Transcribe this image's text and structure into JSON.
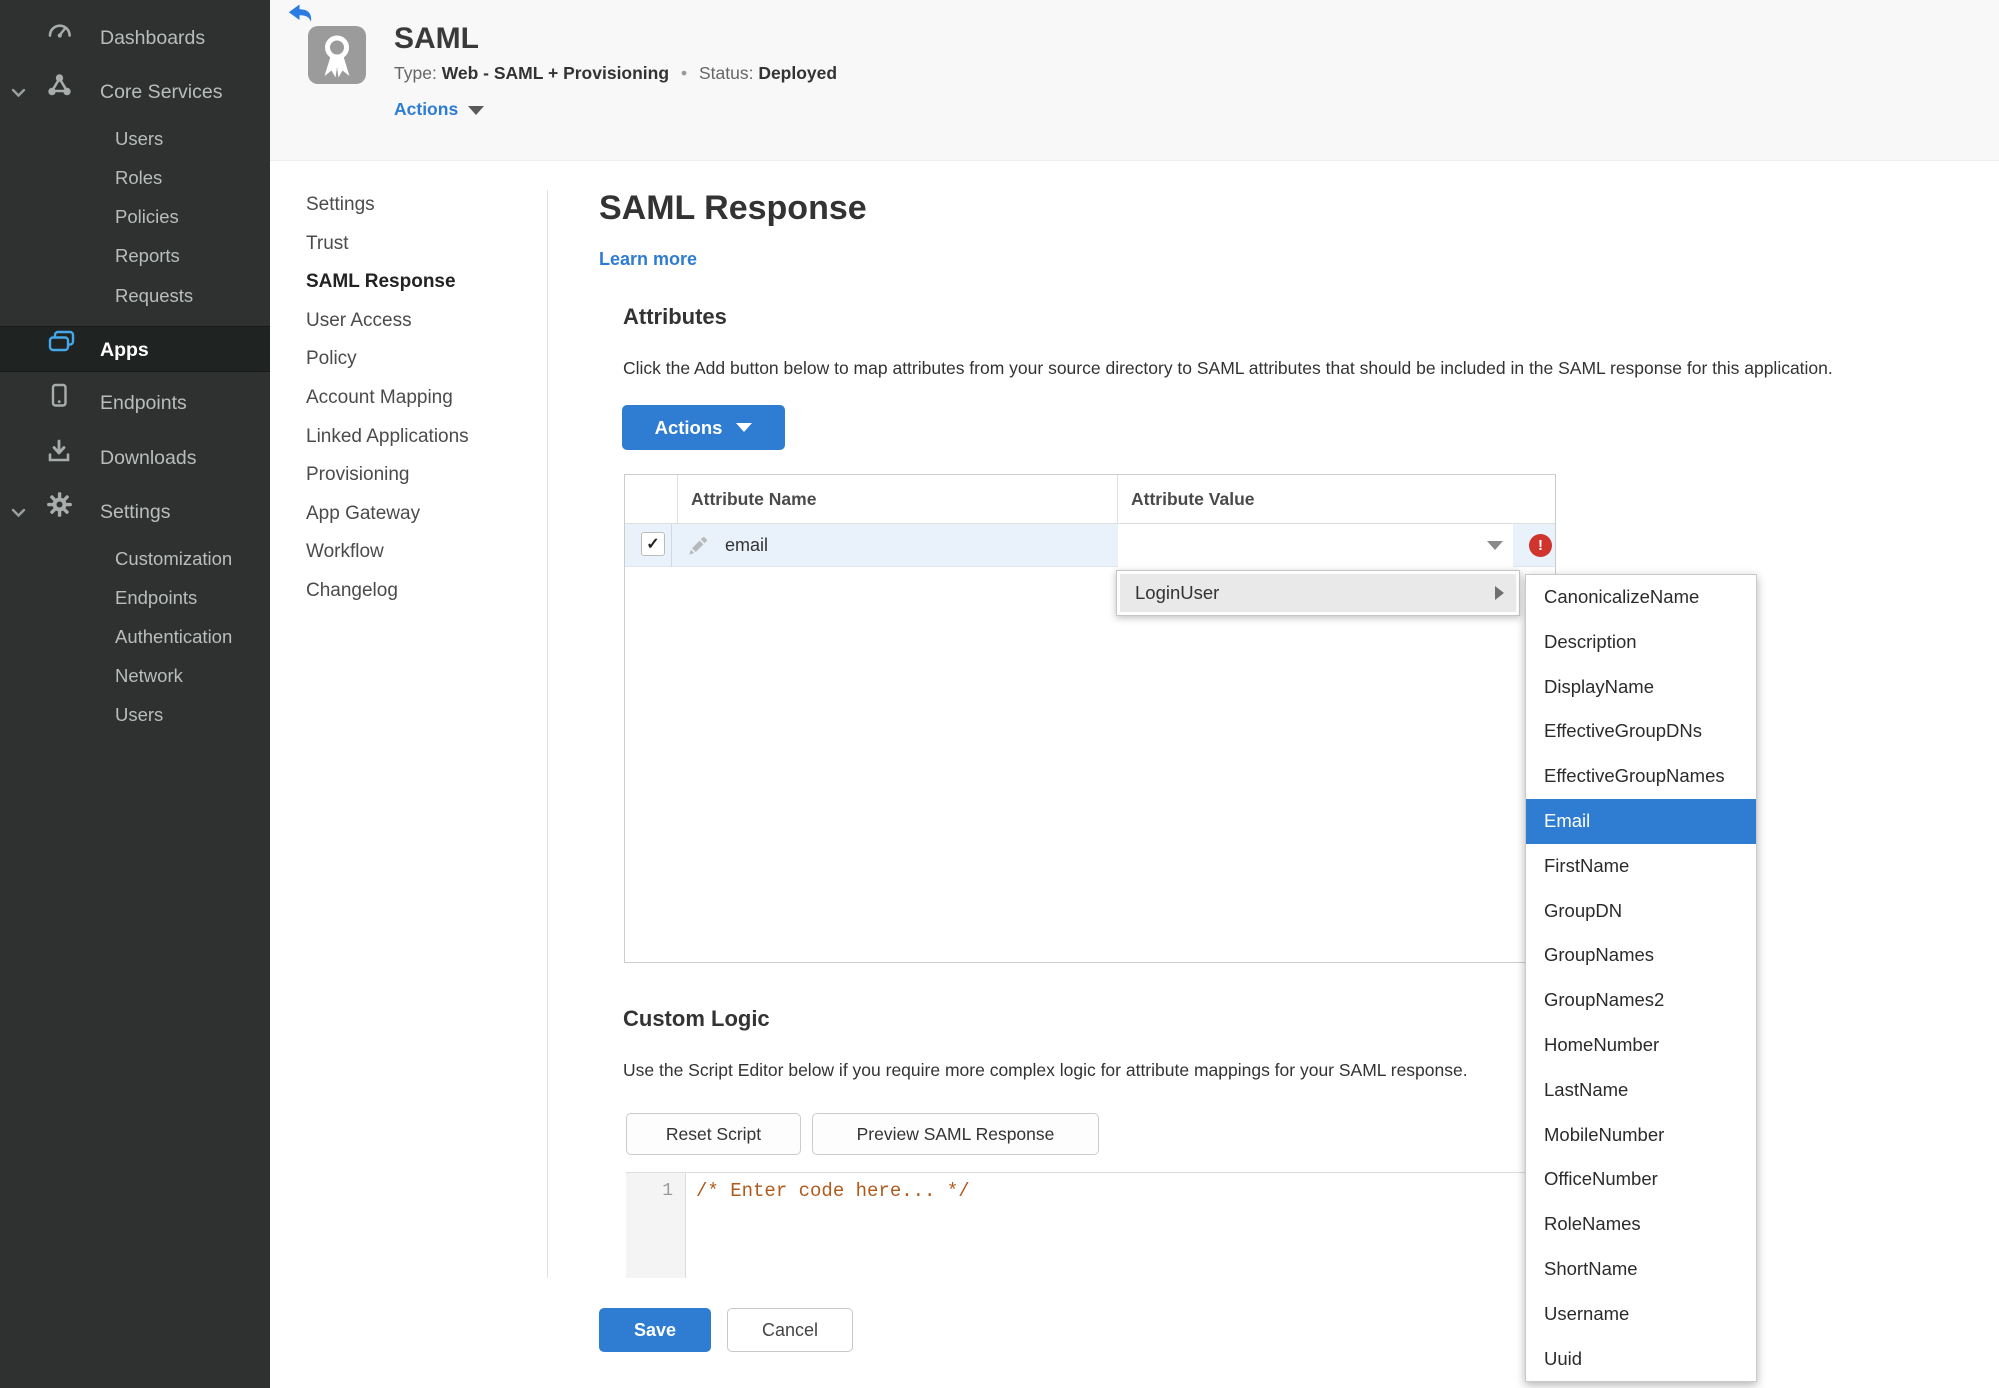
{
  "colors": {
    "accent_blue": "#2f7cd3",
    "status_green": "#3b8d22",
    "error_red": "#cf352c",
    "code_comment_orange": "#b05a1e",
    "row_highlight_blue": "#e9f1fb",
    "sidebar_dark": "#2e312f"
  },
  "sidebar": {
    "items": [
      "Dashboards",
      "Core Services",
      "Users",
      "Roles",
      "Policies",
      "Reports",
      "Requests",
      "Apps",
      "Endpoints",
      "Downloads",
      "Settings",
      "Customization",
      "Endpoints",
      "Authentication",
      "Network",
      "Users"
    ],
    "active": "Apps"
  },
  "header": {
    "title": "SAML",
    "type_label": "Type:",
    "type_value": "Web - SAML + Provisioning",
    "bullet": "•",
    "status_label": "Status:",
    "status_value": "Deployed",
    "actions_label": "Actions"
  },
  "subnav": {
    "items": [
      "Settings",
      "Trust",
      "SAML Response",
      "User Access",
      "Policy",
      "Account Mapping",
      "Linked Applications",
      "Provisioning",
      "App Gateway",
      "Workflow",
      "Changelog"
    ],
    "active": "SAML Response"
  },
  "main": {
    "title": "SAML Response",
    "learn_more": "Learn more",
    "attributes_heading": "Attributes",
    "attributes_description": "Click the Add button below to map attributes from your source directory to SAML attributes that should be included in the SAML response for this application.",
    "actions_button": "Actions",
    "table": {
      "columns": [
        "Attribute Name",
        "Attribute Value"
      ],
      "row": {
        "name": "email",
        "checked": true,
        "check_glyph": "✓",
        "error_glyph": "!"
      }
    },
    "custom_logic_heading": "Custom Logic",
    "custom_logic_description": "Use the Script Editor below if you require more complex logic for attribute mappings for your SAML response.",
    "reset_button": "Reset Script",
    "preview_button": "Preview SAML Response",
    "editor": {
      "line_number": "1",
      "code": "/* Enter code here... */"
    },
    "save_button": "Save",
    "cancel_button": "Cancel"
  },
  "menus": {
    "parent_item": "LoginUser",
    "submenu": [
      "CanonicalizeName",
      "Description",
      "DisplayName",
      "EffectiveGroupDNs",
      "EffectiveGroupNames",
      "Email",
      "FirstName",
      "GroupDN",
      "GroupNames",
      "GroupNames2",
      "HomeNumber",
      "LastName",
      "MobileNumber",
      "OfficeNumber",
      "RoleNames",
      "ShortName",
      "Username",
      "Uuid"
    ],
    "selected": "Email"
  }
}
